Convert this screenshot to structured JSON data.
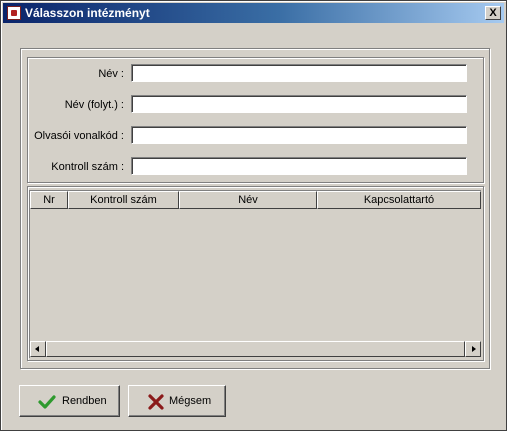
{
  "window": {
    "title": "Válasszon intézményt",
    "close_symbol": "X"
  },
  "form": {
    "fields": [
      {
        "label": "Név :",
        "value": ""
      },
      {
        "label": "Név (folyt.) :",
        "value": ""
      },
      {
        "label": "Olvasói vonalkód :",
        "value": ""
      },
      {
        "label": "Kontroll szám :",
        "value": ""
      }
    ]
  },
  "table": {
    "columns": [
      "Nr",
      "Kontroll szám",
      "Név",
      "Kapcsolattartó"
    ],
    "rows": []
  },
  "buttons": {
    "ok_label": "Rendben",
    "cancel_label": "Mégsem"
  },
  "colors": {
    "ok_icon": "#2e9a2e",
    "cancel_icon": "#8b1a1a"
  }
}
